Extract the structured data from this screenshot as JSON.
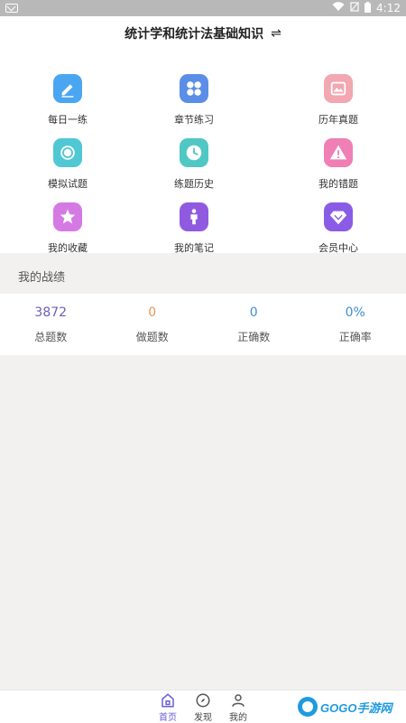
{
  "status_bar": {
    "time": "4:12"
  },
  "header": {
    "title": "统计学和统计法基础知识",
    "swap_icon": "⇌"
  },
  "grid": [
    {
      "label": "每日一练",
      "icon": "pencil-icon",
      "color": "#4aa6f0"
    },
    {
      "label": "章节练习",
      "icon": "grid-icon",
      "color": "#5b8ee6"
    },
    {
      "label": "历年真题",
      "icon": "image-icon",
      "color": "#f2a7b1"
    },
    {
      "label": "模拟试题",
      "icon": "sun-icon",
      "color": "#4fc8d4"
    },
    {
      "label": "练题历史",
      "icon": "clock-icon",
      "color": "#4fc8c4"
    },
    {
      "label": "我的错题",
      "icon": "warning-icon",
      "color": "#ef7fb5"
    },
    {
      "label": "我的收藏",
      "icon": "star-icon",
      "color": "#d57ae4"
    },
    {
      "label": "我的笔记",
      "icon": "person-icon",
      "color": "#8f5ae0"
    },
    {
      "label": "会员中心",
      "icon": "diamond-icon",
      "color": "#8a5ce6"
    }
  ],
  "record": {
    "title": "我的战绩",
    "stats": [
      {
        "value": "3872",
        "label": "总题数",
        "color": "#6b5fb5"
      },
      {
        "value": "0",
        "label": "做题数",
        "color": "#e8955a"
      },
      {
        "value": "0",
        "label": "正确数",
        "color": "#3f8fd0"
      },
      {
        "value": "0%",
        "label": "正确率",
        "color": "#3f8fd0"
      }
    ]
  },
  "bottom_nav": [
    {
      "label": "首页",
      "icon": "home-icon",
      "active": true
    },
    {
      "label": "发现",
      "icon": "compass-icon",
      "active": false
    },
    {
      "label": "我的",
      "icon": "user-icon",
      "active": false
    }
  ],
  "watermark": {
    "text": "GOGO手游网"
  }
}
